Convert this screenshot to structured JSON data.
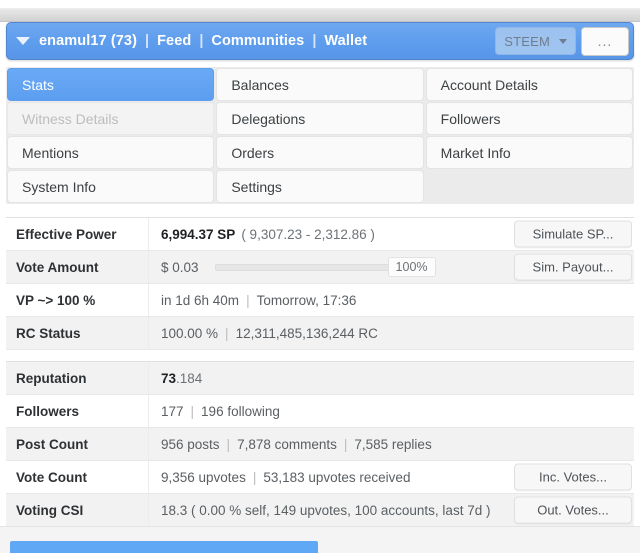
{
  "navbar": {
    "caret_icon": "caret-down-icon",
    "account": "enamul17 (73)",
    "sep": "|",
    "links": [
      "Feed",
      "Communities",
      "Wallet"
    ],
    "coin_label": "STEEM",
    "coin_caret_icon": "chevron-down-icon",
    "more_label": "...",
    "accent_color": "#5f9ded"
  },
  "tabs": [
    {
      "label": "Stats",
      "state": "active"
    },
    {
      "label": "Balances",
      "state": "normal"
    },
    {
      "label": "Account Details",
      "state": "normal"
    },
    {
      "label": "Witness Details",
      "state": "disabled"
    },
    {
      "label": "Delegations",
      "state": "normal"
    },
    {
      "label": "Followers",
      "state": "normal"
    },
    {
      "label": "Mentions",
      "state": "normal"
    },
    {
      "label": "Orders",
      "state": "normal"
    },
    {
      "label": "Market Info",
      "state": "normal"
    },
    {
      "label": "System Info",
      "state": "normal"
    },
    {
      "label": "Settings",
      "state": "normal"
    },
    {
      "label": "",
      "state": "empty"
    }
  ],
  "stats": {
    "effective_power": {
      "label": "Effective Power",
      "value_strong": "6,994.37 SP",
      "value_dim": "( 9,307.23 - 2,312.86 )",
      "action": "Simulate SP..."
    },
    "vote_amount": {
      "label": "Vote Amount",
      "value": "$ 0.03",
      "progress_percent": 100,
      "progress_label": "100%",
      "action": "Sim. Payout..."
    },
    "vp": {
      "label": "VP ~> 100 %",
      "value_a": "in 1d 6h 40m",
      "sep": "|",
      "value_b": "Tomorrow, 17:36"
    },
    "rc": {
      "label": "RC Status",
      "value_a": "100.00 %",
      "sep": "|",
      "value_b": "12,311,485,136,244 RC"
    },
    "reputation": {
      "label": "Reputation",
      "value_strong": "73",
      "value_dim": ".184"
    },
    "followers": {
      "label": "Followers",
      "value_a": "177",
      "sep": "|",
      "value_b": "196 following"
    },
    "post_count": {
      "label": "Post Count",
      "value_a": "956 posts",
      "sep1": "|",
      "value_b": "7,878 comments",
      "sep2": "|",
      "value_c": "7,585 replies"
    },
    "vote_count": {
      "label": "Vote Count",
      "value_a": "9,356 upvotes",
      "sep": "|",
      "value_b": "53,183 upvotes received",
      "action": "Inc. Votes..."
    },
    "voting_csi": {
      "label": "Voting CSI",
      "value": "18.3 ( 0.00 % self, 149 upvotes, 100 accounts, last 7d )",
      "action": "Out. Votes..."
    }
  },
  "bottom": {
    "bar_color": "#5fa8f5"
  }
}
